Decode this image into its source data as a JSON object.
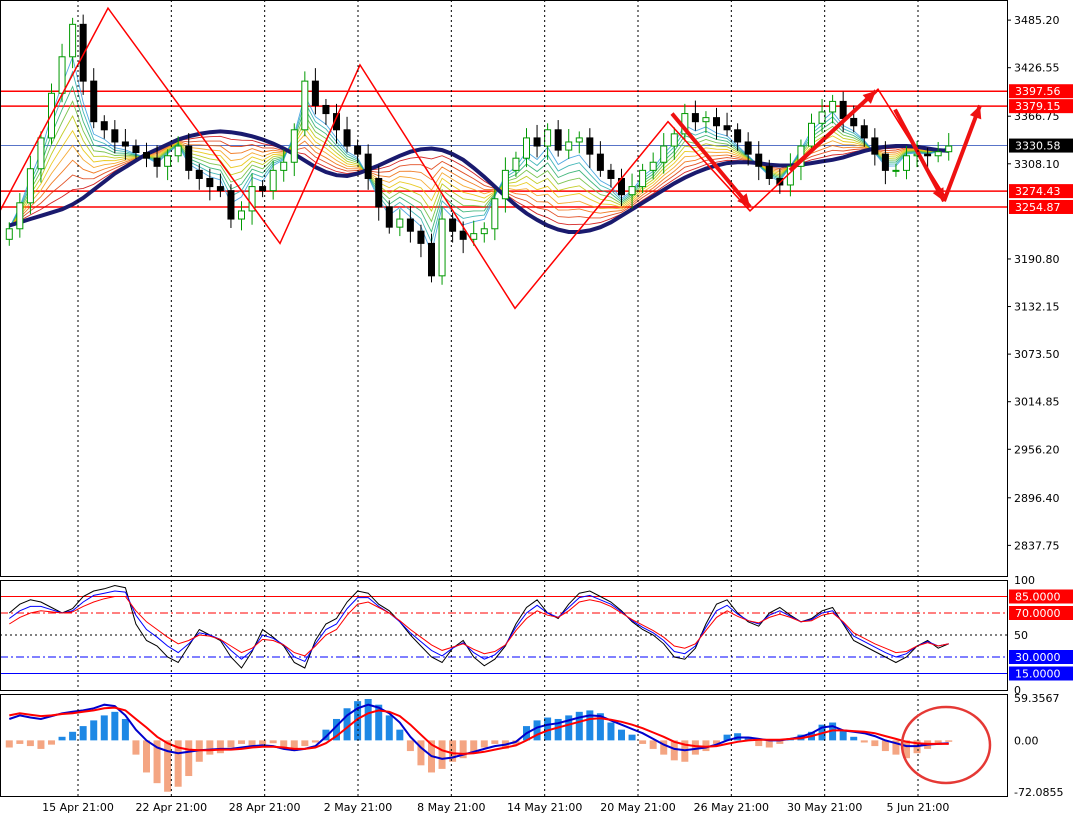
{
  "chart_data": [
    {
      "type": "candlestick",
      "panel": "price",
      "y_ticks": [
        "3485.20",
        "3426.55",
        "3366.75",
        "3308.10",
        "3190.80",
        "3132.15",
        "3073.50",
        "3014.85",
        "2956.20",
        "2896.40",
        "2837.75"
      ],
      "ylim": [
        2800,
        3510
      ],
      "price_lines": [
        {
          "label": "3397.56",
          "value": 3397.56,
          "color": "#ff0000",
          "style": "solid",
          "tag": "red"
        },
        {
          "label": "3379.15",
          "value": 3379.15,
          "color": "#ff0000",
          "style": "solid",
          "tag": "red"
        },
        {
          "label": "3330.58",
          "value": 3330.58,
          "color": "#4060c0",
          "style": "solid",
          "tag": "black"
        },
        {
          "label": "3274.43",
          "value": 3274.43,
          "color": "#ff0000",
          "style": "solid",
          "tag": "red"
        },
        {
          "label": "3254.87",
          "value": 3254.87,
          "color": "#ff0000",
          "style": "solid",
          "tag": "red"
        }
      ],
      "zigzag_points": [
        [
          0,
          3250
        ],
        [
          1,
          3500
        ],
        [
          2,
          3210
        ],
        [
          3,
          3430
        ],
        [
          4,
          3130
        ],
        [
          5,
          3360
        ],
        [
          6,
          3250
        ],
        [
          7,
          3400
        ],
        [
          8,
          3268
        ]
      ],
      "series": [
        {
          "name": "",
          "values": [
            3232,
            3236,
            3240,
            3244,
            3248,
            3252,
            3258,
            3266,
            3276,
            3286,
            3296,
            3304,
            3312,
            3320,
            3326,
            3332,
            3338,
            3342,
            3345,
            3347,
            3348,
            3347,
            3345,
            3342,
            3338,
            3333,
            3327,
            3320,
            3312,
            3304,
            3298,
            3294,
            3293,
            3296,
            3301,
            3306,
            3312,
            3318,
            3323,
            3326,
            3327,
            3325,
            3320,
            3313,
            3303,
            3292,
            3280,
            3268,
            3257,
            3247,
            3239,
            3232,
            3227,
            3224,
            3224,
            3226,
            3230,
            3236,
            3244,
            3252,
            3260,
            3268,
            3276,
            3284,
            3291,
            3297,
            3302,
            3306,
            3309,
            3310,
            3310,
            3309,
            3307,
            3306,
            3306,
            3307,
            3309,
            3311,
            3313,
            3316,
            3320,
            3324,
            3327,
            3329,
            3330,
            3330,
            3329,
            3327,
            3325,
            3324
          ]
        }
      ],
      "candles": {
        "open": [
          3215,
          3228,
          3260,
          3302,
          3340,
          3395,
          3440,
          3480,
          3410,
          3360,
          3350,
          3335,
          3330,
          3322,
          3315,
          3305,
          3318,
          3330,
          3300,
          3290,
          3280,
          3275,
          3240,
          3250,
          3280,
          3275,
          3300,
          3310,
          3350,
          3410,
          3380,
          3370,
          3350,
          3330,
          3320,
          3290,
          3255,
          3230,
          3240,
          3225,
          3210,
          3170,
          3240,
          3225,
          3215,
          3222,
          3228,
          3265,
          3300,
          3315,
          3340,
          3330,
          3350,
          3325,
          3335,
          3340,
          3320,
          3300,
          3290,
          3270,
          3280,
          3300,
          3310,
          3330,
          3345,
          3370,
          3360,
          3365,
          3355,
          3350,
          3335,
          3320,
          3305,
          3290,
          3282,
          3305,
          3330,
          3358,
          3372,
          3385,
          3364,
          3355,
          3340,
          3320,
          3300,
          3300,
          3318,
          3320,
          3318,
          3323
        ],
        "close": [
          3228,
          3260,
          3302,
          3340,
          3395,
          3440,
          3480,
          3410,
          3360,
          3350,
          3335,
          3330,
          3322,
          3315,
          3305,
          3318,
          3330,
          3300,
          3290,
          3280,
          3275,
          3240,
          3250,
          3280,
          3275,
          3300,
          3310,
          3350,
          3410,
          3380,
          3370,
          3350,
          3330,
          3320,
          3290,
          3255,
          3230,
          3240,
          3225,
          3210,
          3170,
          3240,
          3225,
          3215,
          3222,
          3228,
          3265,
          3300,
          3315,
          3340,
          3330,
          3350,
          3325,
          3335,
          3340,
          3320,
          3300,
          3290,
          3270,
          3280,
          3300,
          3310,
          3330,
          3345,
          3370,
          3360,
          3365,
          3355,
          3350,
          3335,
          3320,
          3305,
          3290,
          3282,
          3305,
          3330,
          3358,
          3372,
          3385,
          3364,
          3355,
          3340,
          3320,
          3300,
          3300,
          3318,
          3320,
          3318,
          3323,
          3330
        ]
      }
    },
    {
      "type": "line",
      "panel": "oscillator",
      "y_ticks": [
        "100",
        "50",
        "0"
      ],
      "ylim": [
        0,
        100
      ],
      "levels": [
        {
          "label": "85.0000",
          "value": 85,
          "color": "#ff0000",
          "style": "solid"
        },
        {
          "label": "70.0000",
          "value": 70,
          "color": "#ff0000",
          "style": "dashdot"
        },
        {
          "label": "30.0000",
          "value": 30,
          "color": "#0000ff",
          "style": "dashdot"
        },
        {
          "label": "15.0000",
          "value": 15,
          "color": "#0000ff",
          "style": "solid"
        }
      ],
      "series": [
        {
          "name": "",
          "color": "#000000",
          "values": [
            70,
            78,
            82,
            80,
            75,
            70,
            74,
            85,
            90,
            92,
            95,
            93,
            60,
            45,
            40,
            30,
            25,
            40,
            55,
            50,
            45,
            30,
            20,
            35,
            55,
            48,
            40,
            25,
            20,
            45,
            60,
            65,
            80,
            90,
            88,
            78,
            72,
            62,
            50,
            40,
            30,
            25,
            38,
            45,
            30,
            22,
            28,
            40,
            60,
            75,
            82,
            70,
            65,
            78,
            88,
            90,
            85,
            80,
            72,
            62,
            55,
            50,
            42,
            30,
            28,
            38,
            60,
            78,
            82,
            70,
            62,
            58,
            70,
            75,
            68,
            62,
            65,
            72,
            75,
            60,
            45,
            40,
            35,
            30,
            25,
            30,
            40,
            45,
            38,
            42
          ]
        },
        {
          "name": "",
          "color": "#0000ff",
          "values": [
            65,
            72,
            76,
            76,
            73,
            70,
            72,
            80,
            86,
            88,
            90,
            89,
            68,
            55,
            48,
            40,
            34,
            42,
            52,
            50,
            46,
            36,
            28,
            36,
            50,
            47,
            41,
            30,
            26,
            42,
            55,
            60,
            74,
            84,
            84,
            76,
            70,
            62,
            52,
            44,
            36,
            31,
            38,
            43,
            34,
            28,
            32,
            41,
            57,
            70,
            77,
            70,
            66,
            75,
            84,
            86,
            82,
            78,
            71,
            63,
            57,
            52,
            45,
            35,
            33,
            40,
            57,
            72,
            77,
            69,
            63,
            60,
            68,
            72,
            67,
            62,
            64,
            70,
            72,
            61,
            49,
            44,
            39,
            34,
            30,
            33,
            40,
            44,
            40,
            42
          ]
        },
        {
          "name": "",
          "color": "#ff0000",
          "values": [
            60,
            66,
            70,
            72,
            71,
            70,
            71,
            76,
            80,
            83,
            85,
            85,
            72,
            62,
            55,
            48,
            42,
            45,
            50,
            49,
            46,
            40,
            34,
            38,
            46,
            45,
            41,
            34,
            31,
            40,
            50,
            55,
            68,
            78,
            80,
            75,
            70,
            63,
            55,
            48,
            41,
            36,
            39,
            42,
            37,
            33,
            35,
            41,
            54,
            65,
            72,
            68,
            66,
            72,
            80,
            82,
            80,
            76,
            70,
            64,
            59,
            54,
            48,
            40,
            38,
            42,
            54,
            66,
            72,
            67,
            63,
            61,
            66,
            69,
            66,
            62,
            63,
            68,
            70,
            62,
            52,
            47,
            42,
            38,
            34,
            35,
            40,
            43,
            40,
            42
          ]
        }
      ]
    },
    {
      "type": "bar",
      "panel": "macd",
      "y_ticks": [
        "59.3567",
        "0.00",
        "-72.0855"
      ],
      "ylim": [
        -78,
        65
      ],
      "series": [
        {
          "name": "",
          "values": [
            -10,
            -5,
            -8,
            -12,
            -6,
            5,
            12,
            20,
            28,
            35,
            40,
            30,
            -20,
            -45,
            -60,
            -72,
            -65,
            -50,
            -30,
            -20,
            -18,
            -10,
            -5,
            -8,
            -6,
            -4,
            -10,
            -15,
            -8,
            -3,
            15,
            30,
            45,
            55,
            58,
            50,
            35,
            15,
            -15,
            -35,
            -45,
            -40,
            -30,
            -25,
            -18,
            -10,
            -5,
            -12,
            -6,
            20,
            28,
            32,
            30,
            35,
            40,
            42,
            38,
            25,
            15,
            8,
            -5,
            -12,
            -20,
            -28,
            -30,
            -20,
            -15,
            -5,
            8,
            10,
            5,
            -8,
            -10,
            -5,
            2,
            8,
            12,
            22,
            25,
            15,
            5,
            -3,
            -8,
            -15,
            -20,
            -25,
            -18,
            -12,
            -6,
            -2
          ]
        },
        {
          "name": "",
          "color": "#0000cc",
          "values": [
            30,
            35,
            32,
            30,
            34,
            38,
            40,
            42,
            45,
            50,
            48,
            35,
            15,
            0,
            -10,
            -15,
            -18,
            -16,
            -14,
            -13,
            -12,
            -12,
            -10,
            -8,
            -7,
            -8,
            -12,
            -14,
            -12,
            -8,
            5,
            20,
            35,
            45,
            50,
            46,
            38,
            25,
            5,
            -10,
            -22,
            -26,
            -24,
            -20,
            -16,
            -12,
            -8,
            -6,
            -2,
            10,
            18,
            22,
            24,
            28,
            32,
            35,
            34,
            28,
            22,
            16,
            10,
            2,
            -6,
            -12,
            -14,
            -12,
            -10,
            -6,
            0,
            4,
            4,
            2,
            0,
            0,
            2,
            5,
            10,
            18,
            20,
            14,
            12,
            10,
            6,
            0,
            -4,
            -8,
            -8,
            -6,
            -5,
            -4
          ]
        },
        {
          "name": "",
          "color": "#ff0000",
          "values": [
            35,
            38,
            36,
            34,
            35,
            37,
            38,
            40,
            42,
            45,
            46,
            42,
            30,
            18,
            5,
            -4,
            -10,
            -13,
            -14,
            -14,
            -13,
            -13,
            -12,
            -10,
            -9,
            -9,
            -10,
            -12,
            -12,
            -10,
            -4,
            6,
            18,
            30,
            38,
            42,
            40,
            34,
            22,
            8,
            -6,
            -14,
            -18,
            -19,
            -18,
            -16,
            -13,
            -10,
            -7,
            0,
            8,
            14,
            18,
            22,
            26,
            30,
            31,
            29,
            26,
            22,
            17,
            11,
            5,
            -2,
            -6,
            -8,
            -9,
            -8,
            -5,
            -2,
            0,
            1,
            1,
            1,
            2,
            3,
            6,
            10,
            14,
            14,
            13,
            12,
            10,
            6,
            2,
            -2,
            -4,
            -5,
            -5,
            -5
          ]
        }
      ]
    }
  ],
  "x_axis": {
    "tick_labels": [
      "15 Apr 21:00",
      "22 Apr 21:00",
      "28 Apr 21:00",
      "2 May 21:00",
      "8 May 21:00",
      "14 May 21:00",
      "20 May 21:00",
      "26 May 21:00",
      "30 May 21:00",
      "5 Jun 21:00"
    ]
  },
  "colors": {
    "bull": "#009900",
    "bear": "#000000",
    "zigzag": "#ff0000",
    "ema_slow": "#1a1a6e",
    "hist_pos": "#1e88e5",
    "hist_neg": "#f4a582",
    "grid": "#000000"
  }
}
